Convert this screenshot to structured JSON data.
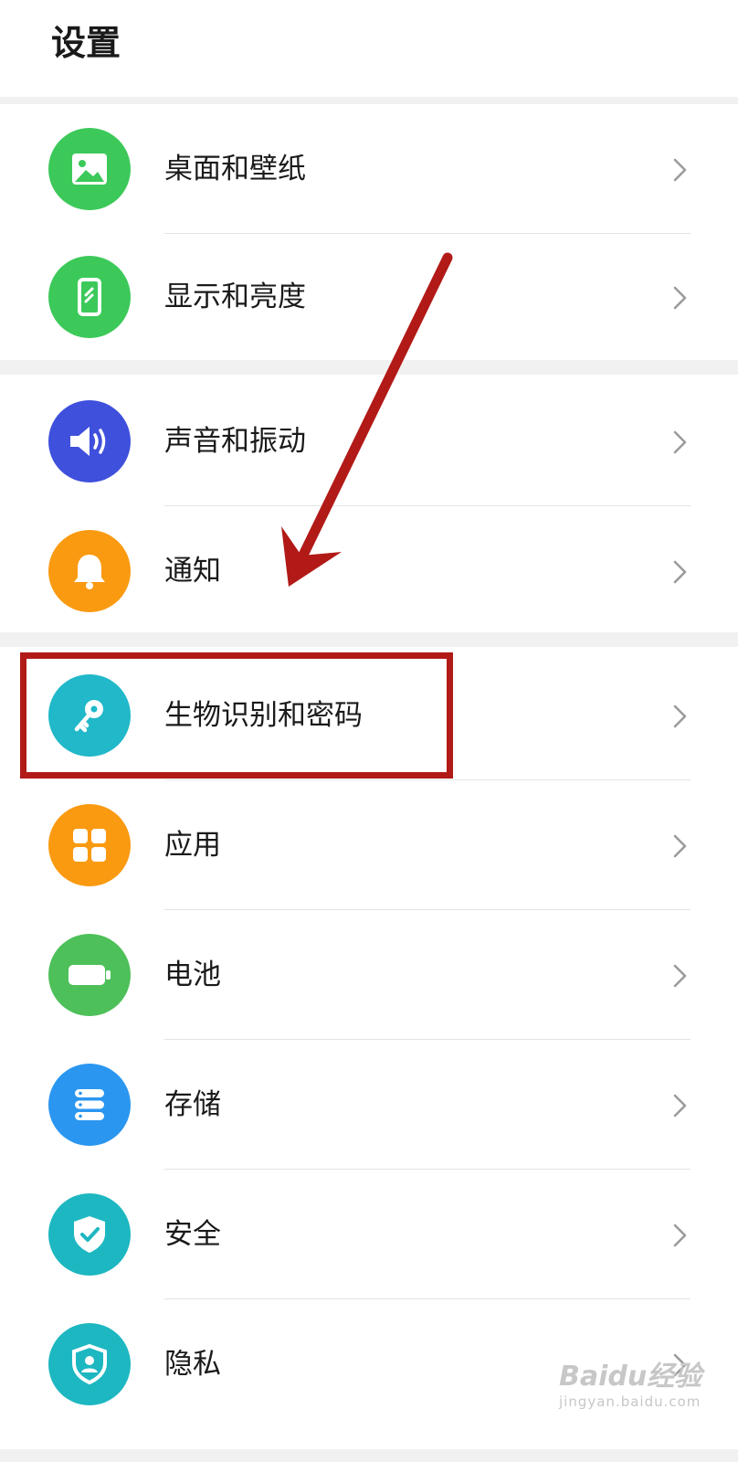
{
  "header": {
    "title": "设置"
  },
  "settings": [
    {
      "label": "桌面和壁纸",
      "icon": "image-icon",
      "color": "#3cc95a"
    },
    {
      "label": "显示和亮度",
      "icon": "phone-display-icon",
      "color": "#3cc95a"
    },
    {
      "label": "声音和振动",
      "icon": "speaker-icon",
      "color": "#3f50dd"
    },
    {
      "label": "通知",
      "icon": "bell-icon",
      "color": "#fa9a11"
    },
    {
      "label": "生物识别和密码",
      "icon": "key-icon",
      "color": "#21b8c9"
    },
    {
      "label": "应用",
      "icon": "apps-grid-icon",
      "color": "#fa9a11"
    },
    {
      "label": "电池",
      "icon": "battery-icon",
      "color": "#4ec05a"
    },
    {
      "label": "存储",
      "icon": "storage-icon",
      "color": "#2a96f0"
    },
    {
      "label": "安全",
      "icon": "shield-check-icon",
      "color": "#1db7c1"
    },
    {
      "label": "隐私",
      "icon": "privacy-shield-icon",
      "color": "#1db7c1"
    }
  ],
  "annotation": {
    "highlight_color": "#b11a17"
  },
  "watermark": {
    "brand": "Baidu经验",
    "domain": "jingyan.baidu.com"
  }
}
